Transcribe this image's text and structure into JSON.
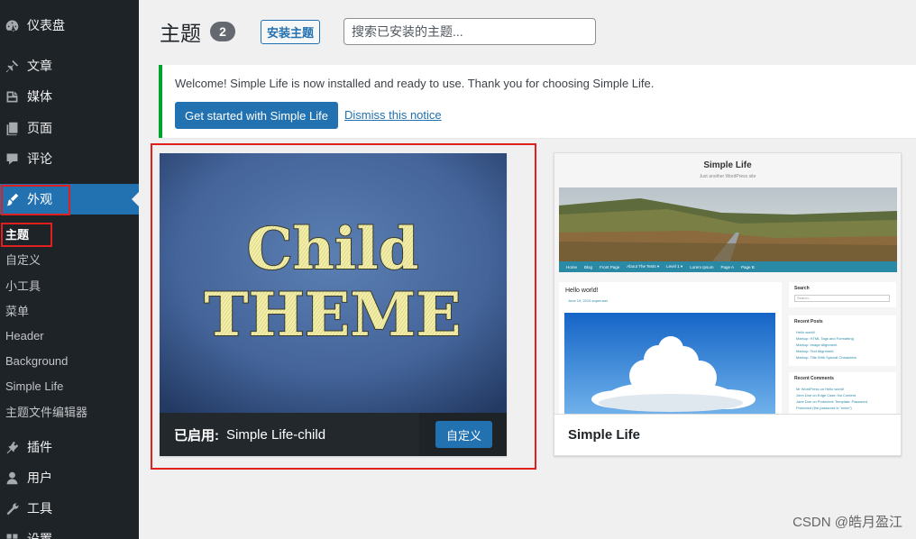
{
  "sidebar": {
    "items": [
      {
        "label": "仪表盘",
        "icon": "dashboard-icon"
      },
      {
        "label": "文章",
        "icon": "pin-icon"
      },
      {
        "label": "媒体",
        "icon": "media-icon"
      },
      {
        "label": "页面",
        "icon": "page-icon"
      },
      {
        "label": "评论",
        "icon": "comment-icon"
      },
      {
        "label": "外观",
        "icon": "paintbrush-icon"
      },
      {
        "label": "插件",
        "icon": "plugin-icon"
      },
      {
        "label": "用户",
        "icon": "user-icon"
      },
      {
        "label": "工具",
        "icon": "wrench-icon"
      },
      {
        "label": "设置",
        "icon": "settings-icon"
      }
    ],
    "submenu": [
      "主题",
      "自定义",
      "小工具",
      "菜单",
      "Header",
      "Background",
      "Simple Life",
      "主题文件编辑器"
    ]
  },
  "header": {
    "title": "主题",
    "count": "2",
    "install_label": "安装主题",
    "search_placeholder": "搜索已安装的主题..."
  },
  "notice": {
    "text": "Welcome! Simple Life is now installed and ready to use. Thank you for choosing Simple Life.",
    "primary_label": "Get started with Simple Life",
    "dismiss_label": "Dismiss this notice"
  },
  "themes": {
    "active": {
      "screenshot_line1": "Child",
      "screenshot_line2": "THEME",
      "active_label": "已启用:",
      "name": "Simple Life-child",
      "customize_label": "自定义"
    },
    "other": {
      "name": "Simple Life",
      "preview": {
        "site_title": "Simple Life",
        "tagline": "Just another WordPress site",
        "nav": [
          "Home",
          "Blog",
          "Front Page",
          "About The Tests ▾",
          "Level 1 ▾",
          "Lorem Ipsum",
          "Page A",
          "Page B"
        ],
        "post_title": "Hello world!",
        "post_meta": "June 19, 2019   superuser",
        "widget_search_title": "Search",
        "widget_search_placeholder": "Search...",
        "recent_posts_title": "Recent Posts",
        "recent_posts": [
          "Hello world!",
          "Markup: HTML Tags and Formatting",
          "Markup: Image Alignment",
          "Markup: Text Alignment",
          "Markup: Title With Special Characters"
        ],
        "recent_comments_title": "Recent Comments",
        "recent_comments": [
          "Mr WordPress on Hello world!",
          "John Doe on Edge Case: No Content",
          "Jane Doe on Protected: Template: Password",
          "Protected (the password is \"enter\")"
        ]
      }
    }
  },
  "watermark": "CSDN @皓月盈江",
  "colors": {
    "sidebar_bg": "#1d2327",
    "accent": "#2271b1",
    "notice_border": "#00a32a",
    "highlight_box": "#e01f1f"
  }
}
